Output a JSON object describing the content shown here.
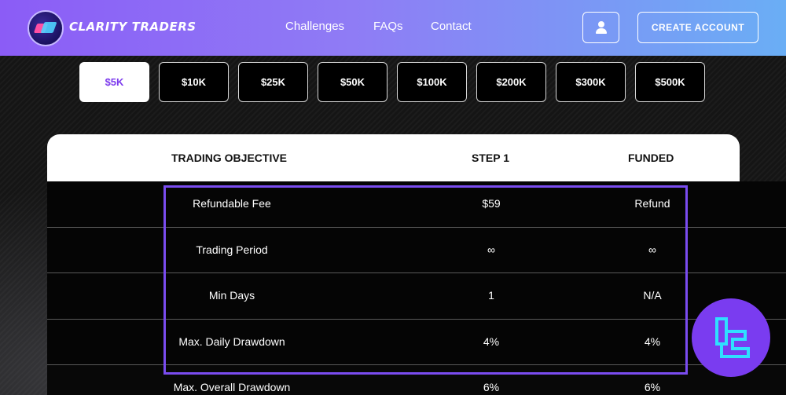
{
  "header": {
    "brand": "CLARITY TRADERS",
    "nav": [
      "Challenges",
      "FAQs",
      "Contact"
    ],
    "create_account": "CREATE ACCOUNT"
  },
  "tabs": [
    {
      "label": "$5K",
      "active": true
    },
    {
      "label": "$10K",
      "active": false
    },
    {
      "label": "$25K",
      "active": false
    },
    {
      "label": "$50K",
      "active": false
    },
    {
      "label": "$100K",
      "active": false
    },
    {
      "label": "$200K",
      "active": false
    },
    {
      "label": "$300K",
      "active": false
    },
    {
      "label": "$500K",
      "active": false
    }
  ],
  "table": {
    "headers": [
      "TRADING OBJECTIVE",
      "STEP 1",
      "FUNDED"
    ],
    "rows": [
      [
        "Refundable Fee",
        "$59",
        "Refund"
      ],
      [
        "Trading Period",
        "∞",
        "∞"
      ],
      [
        "Min Days",
        "1",
        "N/A"
      ],
      [
        "Max. Daily Drawdown",
        "4%",
        "4%"
      ],
      [
        "Max. Overall Drawdown",
        "6%",
        "6%"
      ]
    ]
  },
  "colors": {
    "accent": "#7c3aed",
    "highlight_border": "#7a4cf0",
    "header_gradient_start": "#8b5cf6",
    "header_gradient_end": "#6aaef5"
  },
  "icons": {
    "user": "user-icon",
    "logo": "brand-logo",
    "badge": "tradingfinder-badge-icon"
  }
}
